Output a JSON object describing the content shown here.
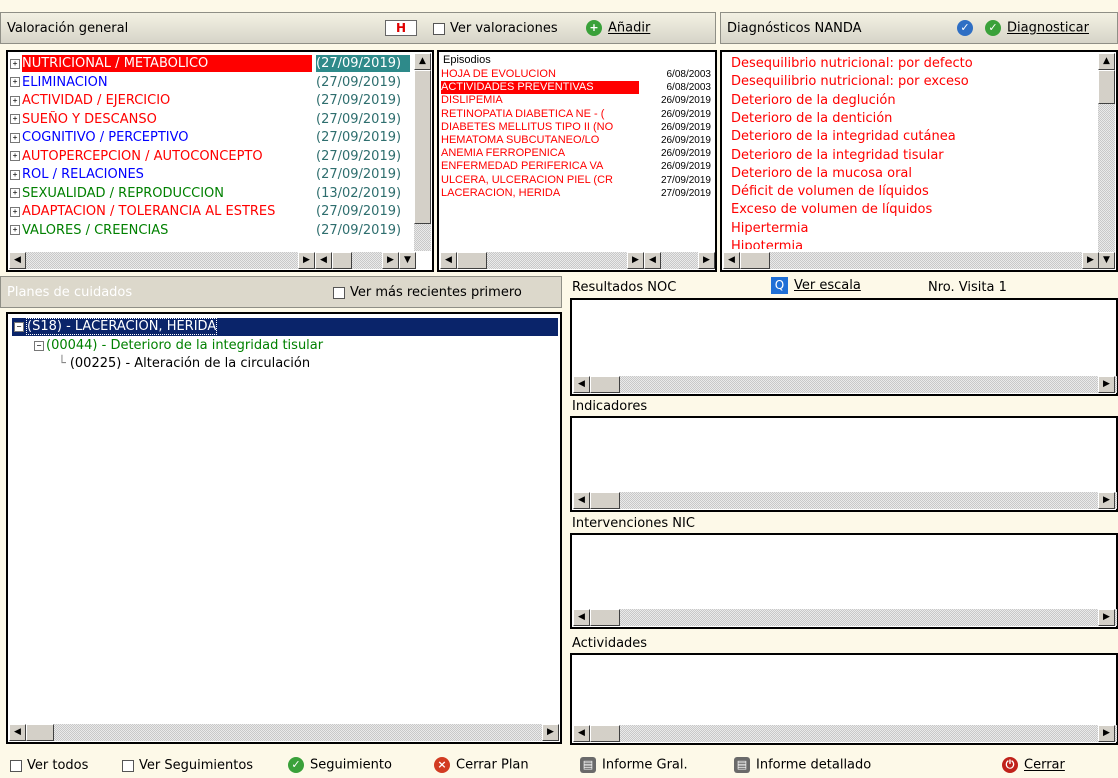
{
  "valoracion": {
    "title": "Valoración general",
    "h_icon": "H",
    "ver_valoraciones": "Ver valoraciones",
    "anadir": "Añadir",
    "items": [
      {
        "label": "NUTRICIONAL / METABOLICO",
        "date": "(27/09/2019)",
        "color": "#ff0000",
        "selected": true
      },
      {
        "label": "ELIMINACION",
        "date": "(27/09/2019)",
        "color": "#0000ff"
      },
      {
        "label": "ACTIVIDAD / EJERCICIO",
        "date": "(27/09/2019)",
        "color": "#ff0000"
      },
      {
        "label": "SUEÑO Y DESCANSO",
        "date": "(27/09/2019)",
        "color": "#ff0000"
      },
      {
        "label": "COGNITIVO / PERCEPTIVO",
        "date": "(27/09/2019)",
        "color": "#0000ff"
      },
      {
        "label": "AUTOPERCEPCION / AUTOCONCEPTO",
        "date": "(27/09/2019)",
        "color": "#ff0000"
      },
      {
        "label": "ROL / RELACIONES",
        "date": "(27/09/2019)",
        "color": "#0000ff"
      },
      {
        "label": "SEXUALIDAD / REPRODUCCION",
        "date": "(13/02/2019)",
        "color": "#008000"
      },
      {
        "label": "ADAPTACION / TOLERANCIA AL ESTRES",
        "date": "(27/09/2019)",
        "color": "#ff0000"
      },
      {
        "label": "VALORES / CREENCIAS",
        "date": "(27/09/2019)",
        "color": "#008000"
      }
    ]
  },
  "episodios": {
    "header": "Episodios",
    "items": [
      {
        "label": "HOJA DE EVOLUCION",
        "date": "6/08/2003"
      },
      {
        "label": "ACTIVIDADES PREVENTIVAS",
        "date": "6/08/2003",
        "selected": true
      },
      {
        "label": "DISLIPEMIA",
        "date": "26/09/2019"
      },
      {
        "label": "RETINOPATIA DIABETICA NE - (",
        "date": "26/09/2019"
      },
      {
        "label": "DIABETES MELLITUS TIPO II (NO",
        "date": "26/09/2019"
      },
      {
        "label": "HEMATOMA SUBCUTANEO/LO",
        "date": "26/09/2019"
      },
      {
        "label": "ANEMIA FERROPENICA",
        "date": "26/09/2019"
      },
      {
        "label": "ENFERMEDAD PERIFERICA VA",
        "date": "26/09/2019"
      },
      {
        "label": "ULCERA, ULCERACION PIEL (CR",
        "date": "27/09/2019"
      },
      {
        "label": "LACERACION, HERIDA",
        "date": "27/09/2019"
      }
    ]
  },
  "nanda": {
    "title": "Diagnósticos NANDA",
    "diagnosticar": "Diagnosticar",
    "items": [
      "Desequilibrio nutricional: por defecto",
      "Desequilibrio nutricional: por exceso",
      "Deterioro de la deglución",
      "Deterioro de la dentición",
      "Deterioro de la integridad cutánea",
      "Deterioro de la integridad tisular",
      "Deterioro de la mucosa oral",
      "Déficit de volumen de líquidos",
      "Exceso de volumen de líquidos",
      "Hipertermia",
      "Hipotermia"
    ]
  },
  "planes": {
    "title": "Planes de cuidados",
    "ver_recientes": "Ver más recientes primero",
    "tree": [
      {
        "label": "(S18) - LACERACION, HERIDA"
      },
      {
        "label": "(00044) - Deterioro de la integridad tisular"
      },
      {
        "label": "(00225) - Alteración de la circulación"
      }
    ]
  },
  "noc": {
    "resultados": "Resultados NOC",
    "ver_escala": "Ver escala",
    "visita": "Nro. Visita 1",
    "indicadores": "Indicadores",
    "intervenciones": "Intervenciones NIC",
    "actividades": "Actividades"
  },
  "footer": {
    "ver_todos": "Ver todos",
    "ver_seguimientos": "Ver Seguimientos",
    "seguimiento": "Seguimiento",
    "cerrar_plan": "Cerrar Plan",
    "informe_gral": "Informe Gral.",
    "informe_detallado": "Informe detallado",
    "cerrar": "Cerrar"
  }
}
